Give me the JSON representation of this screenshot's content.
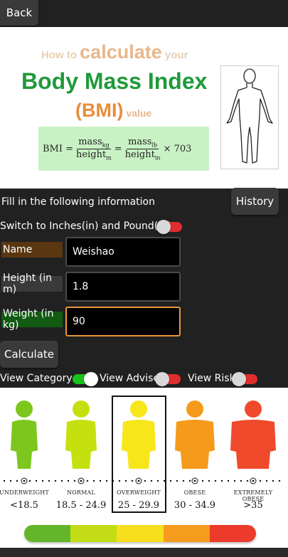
{
  "nav": {
    "back_label": "Back"
  },
  "banner": {
    "line1_pre": "How to ",
    "line1_big": "calculate",
    "line1_post": " your",
    "line2": "Body Mass Index",
    "line3_main": "(BMI)",
    "line3_small": " value",
    "formula": {
      "lhs": "BMI =",
      "num1": "mass",
      "num1_sub": "kg",
      "den1": "height",
      "den1_sub": "m",
      "eq": "=",
      "num2": "mass",
      "num2_sub": "lb",
      "den2": "height",
      "den2_sub": "in",
      "mult": "× 703"
    },
    "figure_icon": "human-silhouette-icon"
  },
  "form": {
    "intro": "Fill in the following information",
    "history_label": "History",
    "switch_label": "Switch to Inches(in) and Pound(lb)",
    "switch_on": false,
    "name_label": "Name",
    "name_value": "Weishao",
    "height_label": "Height (in m)",
    "height_value": "1.8",
    "weight_label": "Weight (in kg)",
    "weight_value": "90",
    "calculate_label": "Calculate"
  },
  "views": {
    "category_label": "View Category",
    "category_on": true,
    "advise_label": "View Advise",
    "advise_on": false,
    "risk_label": "View Risk",
    "risk_on": false
  },
  "chart": {
    "highlighted": "OVERWEIGHT",
    "categories": [
      {
        "name": "UNDERWEIGHT",
        "range": "<18.5",
        "color": "#7cc61e"
      },
      {
        "name": "NORMAL",
        "range": "18.5 - 24.9",
        "color": "#c5e00f"
      },
      {
        "name": "OVERWEIGHT",
        "range": "25 - 29.9",
        "color": "#f7e61a"
      },
      {
        "name": "OBESE",
        "range": "30 - 34.9",
        "color": "#f59a1b"
      },
      {
        "name": "EXTREMELY OBESE",
        "range": ">35",
        "color": "#ef4a2b"
      }
    ],
    "bar_colors": [
      "#64b52a",
      "#c2dd15",
      "#f8df1e",
      "#f59b1d",
      "#ec3a2b"
    ]
  },
  "colors": {
    "background": "#212121",
    "button": "#3a3a3a",
    "toggle_on": "#19c219",
    "toggle_off": "#e02d2d",
    "weight_focus": "#e8953a"
  }
}
